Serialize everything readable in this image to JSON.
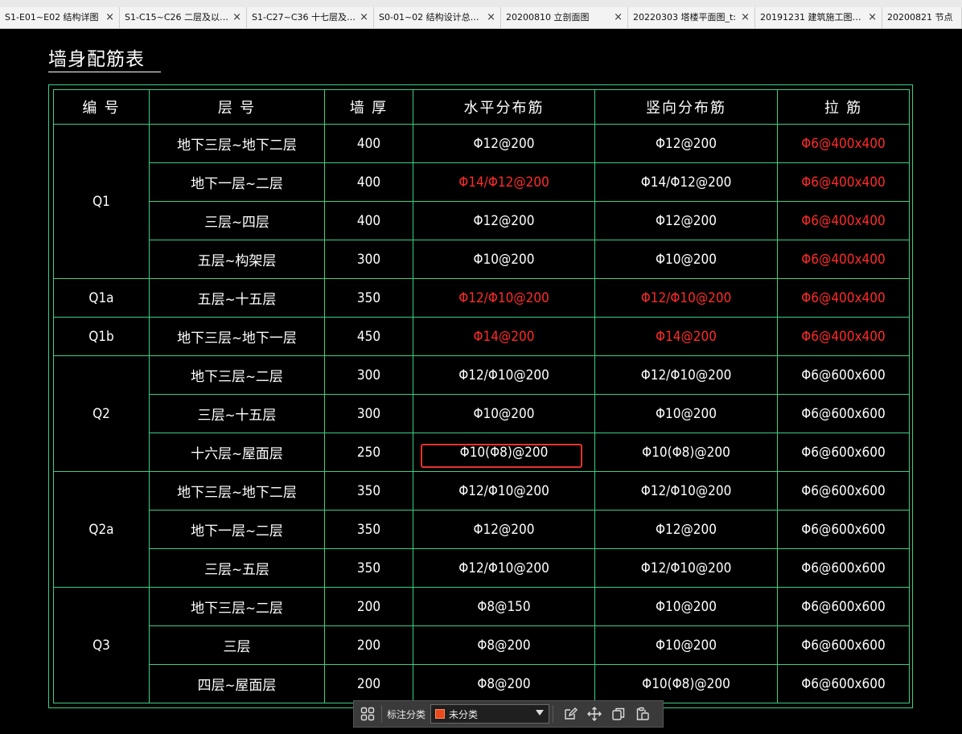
{
  "tabs": [
    {
      "label": "S1-E01~E02  结构详图",
      "close": "×"
    },
    {
      "label": "S1-C15~C26 二层及以…",
      "close": "×"
    },
    {
      "label": "S1-C27~C36 十七层及…",
      "close": "×"
    },
    {
      "label": "S0-01~02 结构设计总…",
      "close": "×"
    },
    {
      "label": "20200810 立剖面图",
      "close": "×"
    },
    {
      "label": "20220303 塔楼平面图_t:",
      "close": "×"
    },
    {
      "label": "20191231 建筑施工图…",
      "close": "×"
    },
    {
      "label": "20200821 节点",
      "close": ""
    }
  ],
  "drawing": {
    "title": "墙身配筋表",
    "headers": [
      "编  号",
      "层        号",
      "墙  厚",
      "水平分布筋",
      "竖向分布筋",
      "拉  筋"
    ],
    "groups": [
      {
        "id": "Q1",
        "rows": [
          {
            "floor": "地下三层~地下二层",
            "thick": "400",
            "horiz": "Φ12@200",
            "vert": "Φ12@200",
            "tie": "Φ6@400x400",
            "red": [
              false,
              false,
              true
            ]
          },
          {
            "floor": "地下一层~二层",
            "thick": "400",
            "horiz": "Φ14/Φ12@200",
            "vert": "Φ14/Φ12@200",
            "tie": "Φ6@400x400",
            "red": [
              true,
              false,
              true
            ]
          },
          {
            "floor": "三层~四层",
            "thick": "400",
            "horiz": "Φ12@200",
            "vert": "Φ12@200",
            "tie": "Φ6@400x400",
            "red": [
              false,
              false,
              true
            ]
          },
          {
            "floor": "五层~构架层",
            "thick": "300",
            "horiz": "Φ10@200",
            "vert": "Φ10@200",
            "tie": "Φ6@400x400",
            "red": [
              false,
              false,
              true
            ]
          }
        ]
      },
      {
        "id": "Q1a",
        "rows": [
          {
            "floor": "五层~十五层",
            "thick": "350",
            "horiz": "Φ12/Φ10@200",
            "vert": "Φ12/Φ10@200",
            "tie": "Φ6@400x400",
            "red": [
              true,
              true,
              true
            ]
          }
        ]
      },
      {
        "id": "Q1b",
        "rows": [
          {
            "floor": "地下三层~地下一层",
            "thick": "450",
            "horiz": "Φ14@200",
            "vert": "Φ14@200",
            "tie": "Φ6@400x400",
            "red": [
              true,
              true,
              true
            ]
          }
        ]
      },
      {
        "id": "Q2",
        "rows": [
          {
            "floor": "地下三层~二层",
            "thick": "300",
            "horiz": "Φ12/Φ10@200",
            "vert": "Φ12/Φ10@200",
            "tie": "Φ6@600x600",
            "red": [
              false,
              false,
              false
            ]
          },
          {
            "floor": "三层~十五层",
            "thick": "300",
            "horiz": "Φ10@200",
            "vert": "Φ10@200",
            "tie": "Φ6@600x600",
            "red": [
              false,
              false,
              false
            ]
          },
          {
            "floor": "十六层~屋面层",
            "thick": "250",
            "horiz": "Φ10(Φ8)@200",
            "vert": "Φ10(Φ8)@200",
            "tie": "Φ6@600x600",
            "red": [
              false,
              false,
              false
            ]
          }
        ]
      },
      {
        "id": "Q2a",
        "rows": [
          {
            "floor": "地下三层~地下二层",
            "thick": "350",
            "horiz": "Φ12/Φ10@200",
            "vert": "Φ12/Φ10@200",
            "tie": "Φ6@600x600",
            "red": [
              false,
              false,
              false
            ]
          },
          {
            "floor": "地下一层~二层",
            "thick": "350",
            "horiz": "Φ12@200",
            "vert": "Φ12@200",
            "tie": "Φ6@600x600",
            "red": [
              false,
              false,
              false
            ]
          },
          {
            "floor": "三层~五层",
            "thick": "350",
            "horiz": "Φ12/Φ10@200",
            "vert": "Φ12/Φ10@200",
            "tie": "Φ6@600x600",
            "red": [
              false,
              false,
              false
            ]
          }
        ]
      },
      {
        "id": "Q3",
        "rows": [
          {
            "floor": "地下三层~二层",
            "thick": "200",
            "horiz": "Φ8@150",
            "vert": "Φ10@200",
            "tie": "Φ6@600x600",
            "red": [
              false,
              false,
              false
            ]
          },
          {
            "floor": "三层",
            "thick": "200",
            "horiz": "Φ8@200",
            "vert": "Φ10@200",
            "tie": "Φ6@600x600",
            "red": [
              false,
              false,
              false
            ]
          },
          {
            "floor": "四层~屋面层",
            "thick": "200",
            "horiz": "Φ8@200",
            "vert": "Φ10(Φ8)@200",
            "tie": "Φ6@600x600",
            "red": [
              false,
              false,
              false
            ]
          }
        ]
      }
    ]
  },
  "float_toolbar": {
    "label": "标注分类",
    "selected": "未分类",
    "swatch_color": "#e8491d",
    "icons": [
      "grid-icon",
      "edit-icon",
      "move-icon",
      "copy-icon",
      "paste-icon"
    ]
  },
  "colors": {
    "grid_line": "#3ccf86",
    "red_text": "#ff2a2a",
    "highlight": "#e8312d"
  }
}
